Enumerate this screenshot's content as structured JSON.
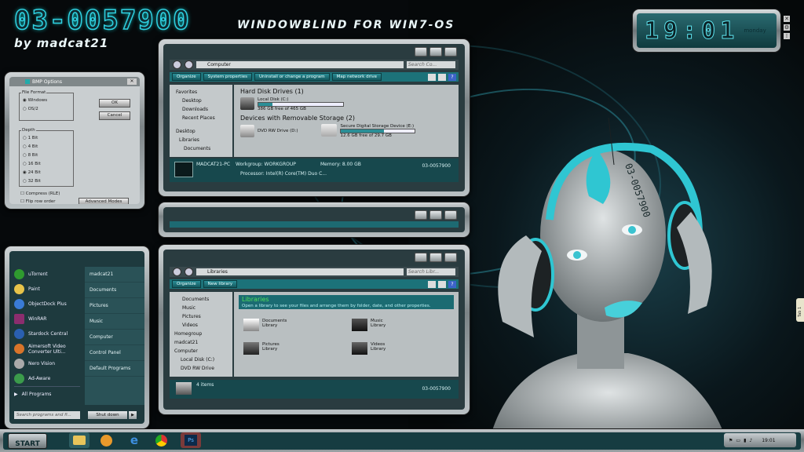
{
  "desktop": {
    "theme_title": "03-0057900",
    "author": "by madcat21",
    "description": "WINDOWBLIND FOR WIN7-OS",
    "side_tab": "Tab 1"
  },
  "clock": {
    "time": "19:01",
    "day": "monday"
  },
  "bmp_dialog": {
    "title": "BMP Options",
    "file_format_label": "File Format",
    "formats": [
      "Windows",
      "OS/2"
    ],
    "depth_label": "Depth",
    "depths": [
      "1 Bit",
      "4 Bit",
      "8 Bit",
      "16 Bit",
      "24 Bit",
      "32 Bit"
    ],
    "ok": "OK",
    "cancel": "Cancel",
    "compress": "Compress (RLE)",
    "flip": "Flip row order",
    "advanced": "Advanced Modes"
  },
  "computer_window": {
    "address": "Computer",
    "search_placeholder": "Search Co...",
    "commands": [
      "Organize",
      "System properties",
      "Uninstall or change a program",
      "Map network drive"
    ],
    "tree": [
      "Favorites",
      "Desktop",
      "Downloads",
      "Recent Places",
      "Desktop",
      "Libraries",
      "Documents"
    ],
    "hdd_section": "Hard Disk Drives (1)",
    "local_disk": "Local Disk (C:)",
    "local_disk_free": "386 GB free of 465 GB",
    "local_disk_used_fraction": 0.17,
    "removable_section": "Devices with Removable Storage (2)",
    "dvd": "DVD RW Drive (D:)",
    "sd_card": "Secure Digital Storage Device (E:)",
    "sd_free": "12.6 GB free of 29.7 GB",
    "sd_used_fraction": 0.58,
    "pc_name": "MADCAT21-PC",
    "workgroup": "Workgroup: WORKGROUP",
    "memory": "Memory: 8.00 GB",
    "processor": "Processor: Intel(R) Core(TM) Duo C...",
    "badge": "03-0057900"
  },
  "libraries_window": {
    "address": "Libraries",
    "search_placeholder": "Search Libr...",
    "commands": [
      "Organize",
      "New library"
    ],
    "tree": [
      "Documents",
      "Music",
      "Pictures",
      "Videos",
      "Homegroup",
      "madcat21",
      "Computer",
      "Local Disk (C:)",
      "DVD RW Drive"
    ],
    "heading": "Libraries",
    "subheading": "Open a library to see your files and arrange them by folder, date, and other properties.",
    "items": [
      {
        "name": "Documents",
        "type": "Library"
      },
      {
        "name": "Music",
        "type": "Library"
      },
      {
        "name": "Pictures",
        "type": "Library"
      },
      {
        "name": "Videos",
        "type": "Library"
      }
    ],
    "status": "4 items",
    "badge": "03-0057900"
  },
  "start_menu": {
    "programs": [
      "uTorrent",
      "Paint",
      "ObjectDock Plus",
      "WinRAR",
      "Stardock Central",
      "Aimersoft Video Converter Ulti...",
      "Nero Vision",
      "Ad-Aware"
    ],
    "all_programs": "All Programs",
    "places": [
      "madcat21",
      "Documents",
      "Pictures",
      "Music",
      "Computer",
      "Control Panel",
      "Default Programs"
    ],
    "search_placeholder": "Search programs and fi...",
    "shutdown": "Shut down"
  },
  "taskbar": {
    "start": "START",
    "tray_time": "19:01"
  }
}
